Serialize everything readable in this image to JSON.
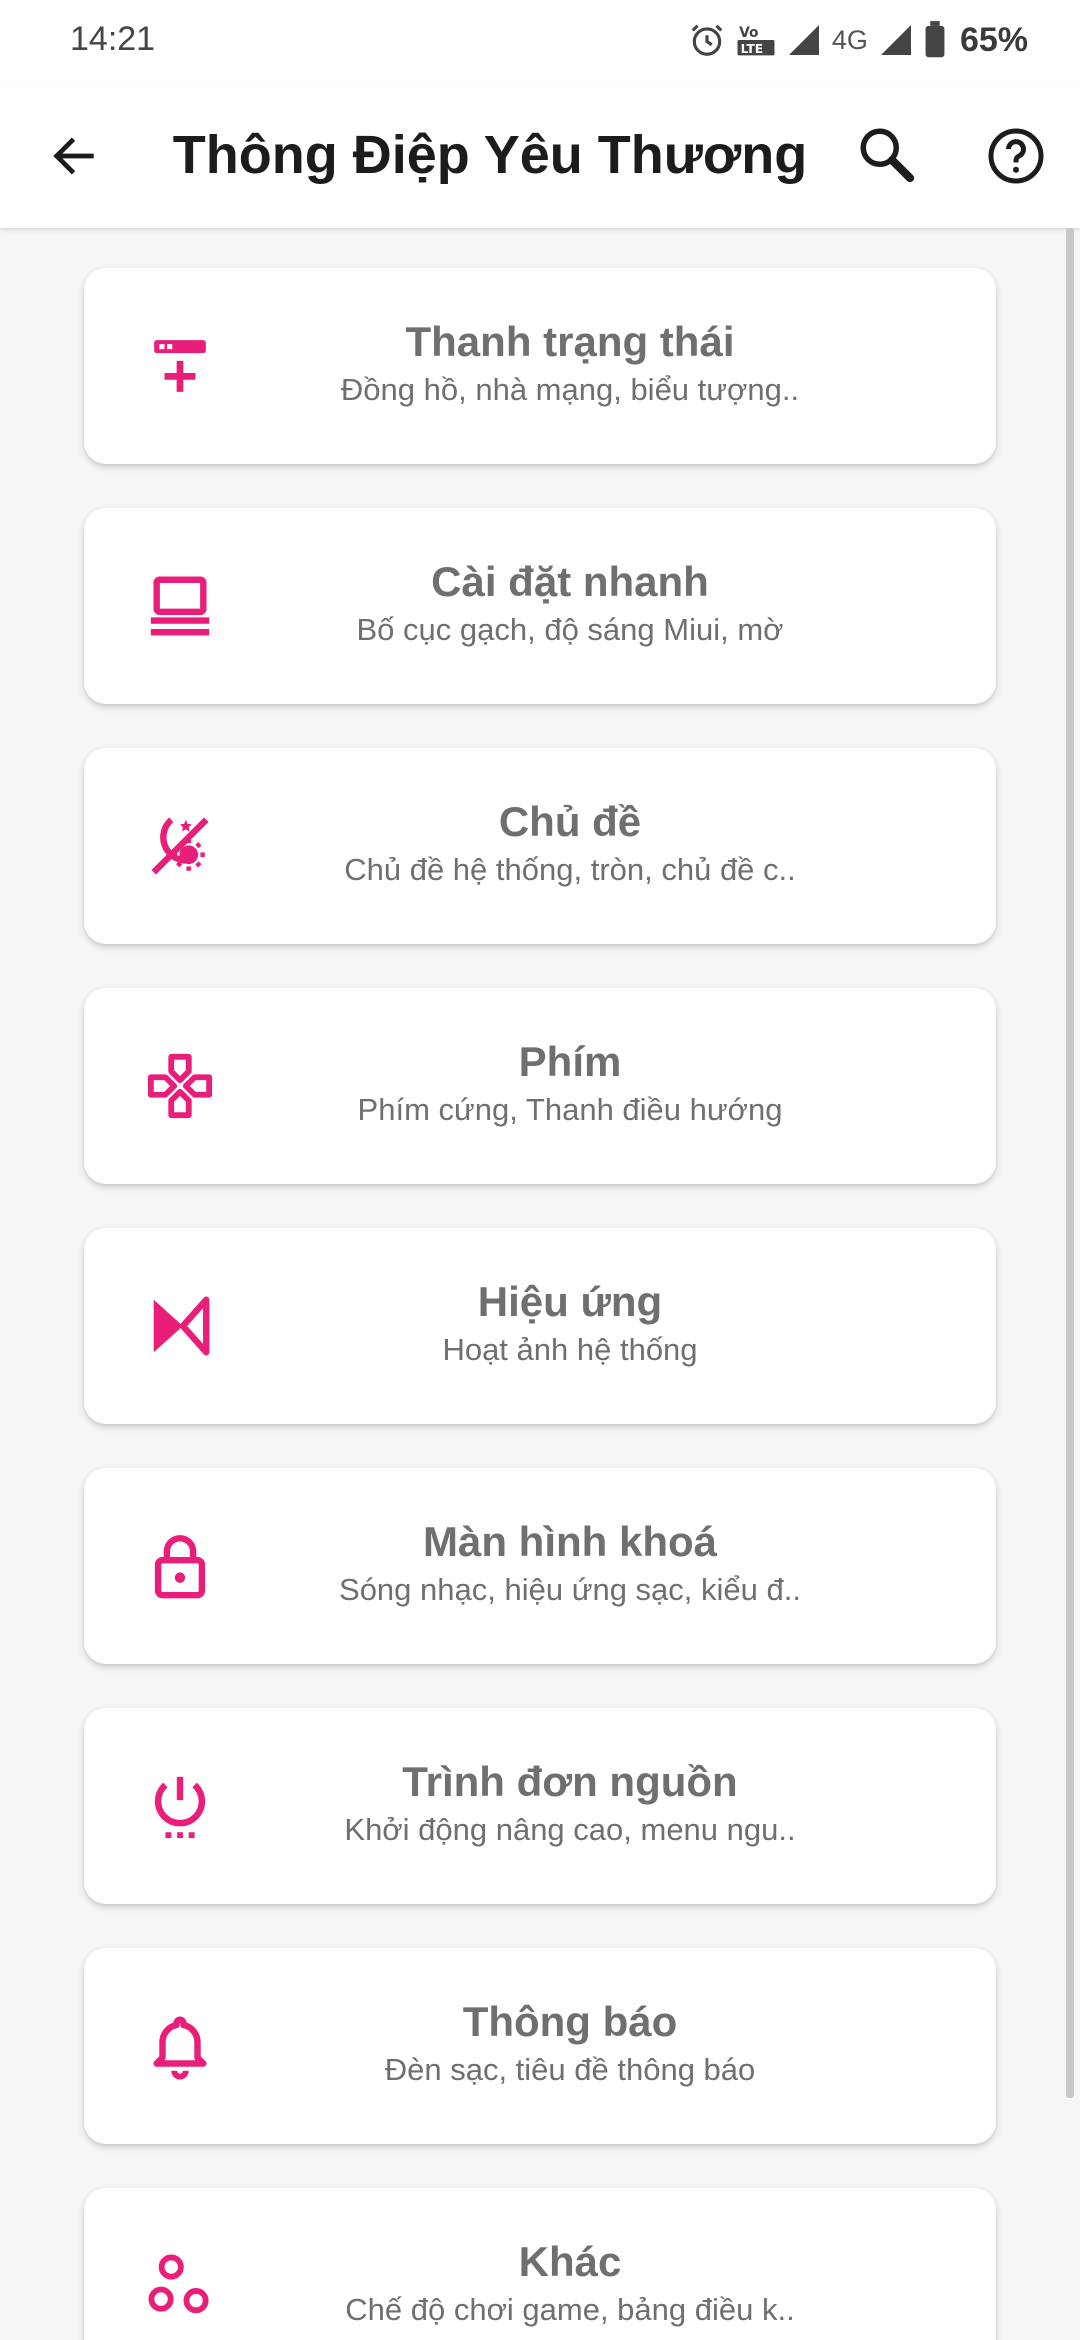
{
  "status_bar": {
    "time": "14:21",
    "network": "4G",
    "battery": "65%",
    "icons": [
      "alarm-icon",
      "volte-icon",
      "signal-icon",
      "signal-icon",
      "battery-icon"
    ]
  },
  "app_bar": {
    "title": "Thông Điệp Yêu Thương",
    "icons": [
      "back-arrow-icon",
      "search-icon",
      "help-icon"
    ]
  },
  "accent_color": "#e91e7a",
  "items": [
    {
      "title": "Thanh trạng thái",
      "subtitle": "Đồng hồ, nhà mạng, biểu tượng..",
      "icon": "status-bar-icon"
    },
    {
      "title": "Cài đặt nhanh",
      "subtitle": "Bố cục gạch, độ sáng Miui, mờ",
      "icon": "laptop-icon"
    },
    {
      "title": "Chủ đề",
      "subtitle": "Chủ đề hệ thống, tròn, chủ đề c..",
      "icon": "theme-icon"
    },
    {
      "title": "Phím",
      "subtitle": "Phím cứng, Thanh điều hướng",
      "icon": "gamepad-icon"
    },
    {
      "title": "Hiệu ứng",
      "subtitle": "Hoạt ảnh hệ thống",
      "icon": "animation-icon"
    },
    {
      "title": "Màn hình khoá",
      "subtitle": "Sóng nhạc, hiệu ứng sạc, kiểu đ..",
      "icon": "lock-icon"
    },
    {
      "title": "Trình đơn nguồn",
      "subtitle": "Khởi động nâng cao, menu ngu..",
      "icon": "power-icon"
    },
    {
      "title": "Thông báo",
      "subtitle": "Đèn sạc, tiêu đề thông báo",
      "icon": "bell-icon"
    },
    {
      "title": "Khác",
      "subtitle": "Chế độ chơi game, bảng điều k..",
      "icon": "bubbles-icon"
    }
  ]
}
